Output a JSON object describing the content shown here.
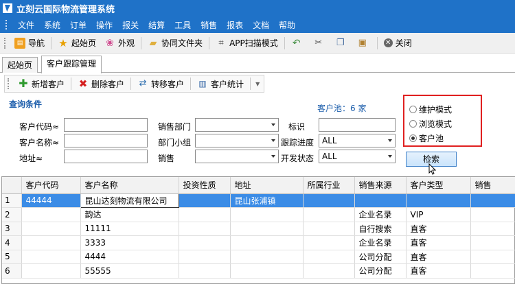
{
  "app": {
    "title": "立刻云国际物流管理系统"
  },
  "menu": [
    "文件",
    "系统",
    "订单",
    "操作",
    "报关",
    "结算",
    "工具",
    "销售",
    "报表",
    "文档",
    "帮助"
  ],
  "toolbar": {
    "nav": "导航",
    "home": "起始页",
    "look": "外观",
    "folder": "协同文件夹",
    "app_scan": "APP扫描模式",
    "close": "关闭"
  },
  "tabs": [
    "起始页",
    "客户跟踪管理"
  ],
  "subtoolbar": {
    "add": "新增客户",
    "delete": "删除客户",
    "transfer": "转移客户",
    "stats": "客户统计"
  },
  "query": {
    "title": "查询条件",
    "pool_label": "客户池：6 家",
    "code_label": "客户代码≈",
    "name_label": "客户名称≈",
    "addr_label": "地址≈",
    "dept_label": "销售部门",
    "group_label": "部门小组",
    "sales_label": "销售",
    "mark_label": "标识",
    "progress_label": "跟踪进度",
    "dev_label": "开发状态",
    "progress_value": "ALL",
    "dev_value": "ALL",
    "search_button": "检索"
  },
  "modes": {
    "maintain": "维护模式",
    "browse": "浏览模式",
    "pool": "客户池",
    "selected": "pool"
  },
  "grid": {
    "columns": [
      "客户代码",
      "客户名称",
      "投资性质",
      "地址",
      "所属行业",
      "销售来源",
      "客户类型",
      "销售"
    ],
    "rows": [
      {
        "n": "1",
        "code": "44444",
        "name": "昆山达刻物流有限公司",
        "invest": "",
        "addr": "昆山张浦镇",
        "industry": "",
        "source": "",
        "type": "",
        "sales": ""
      },
      {
        "n": "2",
        "code": "",
        "name": "韵达",
        "invest": "",
        "addr": "",
        "industry": "",
        "source": "企业名录",
        "type": "VIP",
        "sales": ""
      },
      {
        "n": "3",
        "code": "",
        "name": "11111",
        "invest": "",
        "addr": "",
        "industry": "",
        "source": "自行搜索",
        "type": "直客",
        "sales": ""
      },
      {
        "n": "4",
        "code": "",
        "name": "3333",
        "invest": "",
        "addr": "",
        "industry": "",
        "source": "企业名录",
        "type": "直客",
        "sales": ""
      },
      {
        "n": "5",
        "code": "",
        "name": "4444",
        "invest": "",
        "addr": "",
        "industry": "",
        "source": "公司分配",
        "type": "直客",
        "sales": ""
      },
      {
        "n": "6",
        "code": "",
        "name": "55555",
        "invest": "",
        "addr": "",
        "industry": "",
        "source": "公司分配",
        "type": "直客",
        "sales": ""
      }
    ]
  }
}
